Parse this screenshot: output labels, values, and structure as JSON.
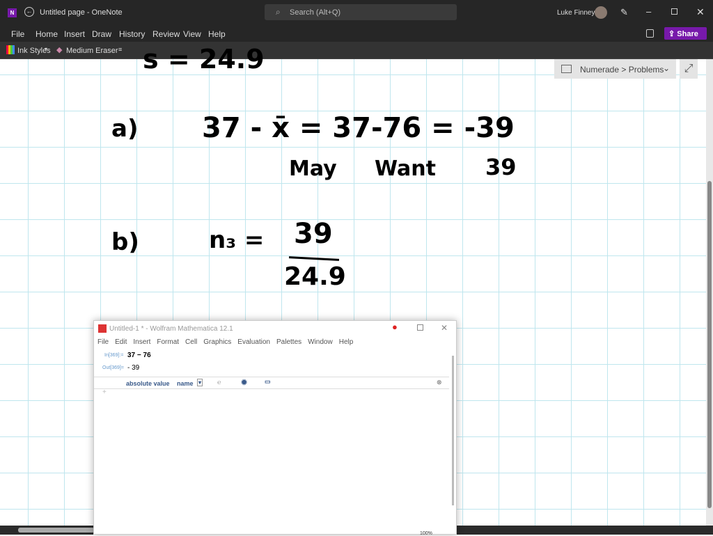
{
  "window": {
    "title": "Untitled page  -  OneNote",
    "search_placeholder": "Search (Alt+Q)",
    "user": "Luke Finney"
  },
  "menu": [
    "File",
    "Home",
    "Insert",
    "Draw",
    "History",
    "Review",
    "View",
    "Help"
  ],
  "share_label": "Share",
  "toolbar": {
    "ink_styles": "Ink Styles",
    "eraser": "Medium Eraser"
  },
  "breadcrumb": "Numerade > Problems",
  "ink": {
    "top_partial": "s = 24.9",
    "a_label": "a)",
    "a_eq": "37 - x̄  =  37-76  =  -39",
    "a_note1": "May",
    "a_note2": "Want",
    "a_note3": "39",
    "b_label": "b)",
    "b_lhs": "n₃ =",
    "b_num": "39",
    "b_den": "24.9"
  },
  "mathematica": {
    "title": "Untitled-1 * - Wolfram Mathematica 12.1",
    "menu": [
      "File",
      "Edit",
      "Insert",
      "Format",
      "Cell",
      "Graphics",
      "Evaluation",
      "Palettes",
      "Window",
      "Help"
    ],
    "in_label": "In[369]:=",
    "in_value": "37 − 76",
    "out_label": "Out[369]=",
    "out_value": "- 39",
    "suggest1": "absolute value",
    "suggest2": "name",
    "zoom": "100%"
  },
  "colors": {
    "accent": "#7719aa",
    "titlebar": "#262626"
  }
}
